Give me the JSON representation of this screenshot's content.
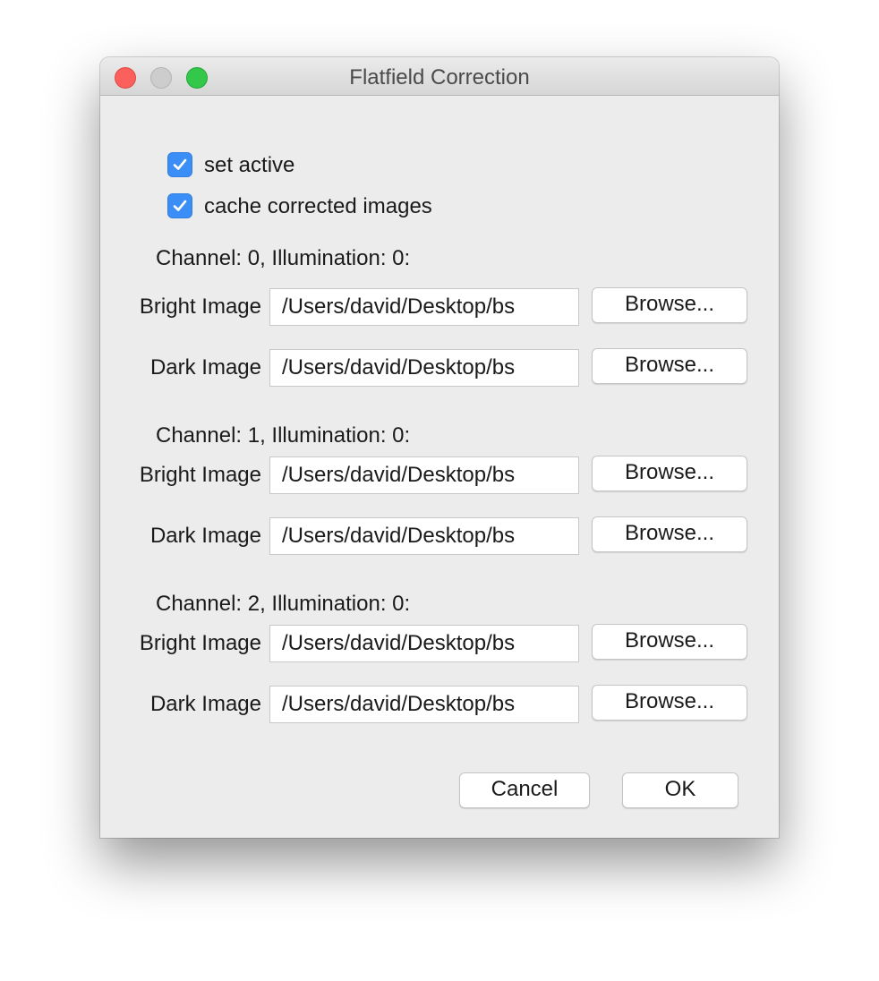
{
  "window": {
    "title": "Flatfield Correction"
  },
  "options": {
    "set_active": {
      "label": "set active",
      "checked": true
    },
    "cache_corrected_images": {
      "label": "cache corrected images",
      "checked": true
    }
  },
  "channels": [
    {
      "header": "Channel: 0, Illumination: 0:",
      "bright": {
        "label": "Bright Image",
        "value": "/Users/david/Desktop/bs",
        "button": "Browse..."
      },
      "dark": {
        "label": "Dark Image",
        "value": "/Users/david/Desktop/bs",
        "button": "Browse..."
      }
    },
    {
      "header": "Channel: 1, Illumination: 0:",
      "bright": {
        "label": "Bright Image",
        "value": "/Users/david/Desktop/bs",
        "button": "Browse..."
      },
      "dark": {
        "label": "Dark Image",
        "value": "/Users/david/Desktop/bs",
        "button": "Browse..."
      }
    },
    {
      "header": "Channel: 2, Illumination: 0:",
      "bright": {
        "label": "Bright Image",
        "value": "/Users/david/Desktop/bs",
        "button": "Browse..."
      },
      "dark": {
        "label": "Dark Image",
        "value": "/Users/david/Desktop/bs",
        "button": "Browse..."
      }
    }
  ],
  "footer": {
    "cancel_label": "Cancel",
    "ok_label": "OK"
  },
  "colors": {
    "checkbox_accent": "#3a8ef6",
    "window_bg": "#ececec",
    "close": "#fc605c",
    "maximize": "#34c84a"
  }
}
